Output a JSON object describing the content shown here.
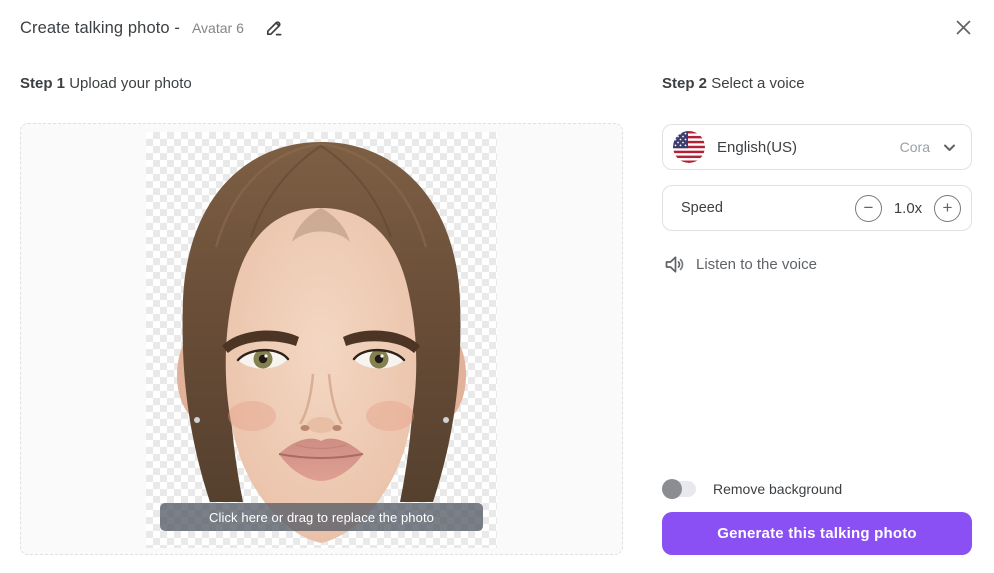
{
  "header": {
    "title": "Create talking photo -",
    "avatar_name": "Avatar 6"
  },
  "steps": {
    "step1_label": "Step 1",
    "step1_text": "Upload your photo",
    "step2_label": "Step 2",
    "step2_text": "Select a voice"
  },
  "upload": {
    "overlay_text": "Click here or drag to replace the photo",
    "photo_description": "woman-portrait-transparent-background"
  },
  "voice": {
    "language": "English(US)",
    "voice_name": "Cora",
    "flag_icon": "us-flag-icon"
  },
  "speed": {
    "label": "Speed",
    "value": "1.0x",
    "decrease_glyph": "−",
    "increase_glyph": "+"
  },
  "listen": {
    "label": "Listen to the voice",
    "icon": "speaker-icon"
  },
  "background_toggle": {
    "label": "Remove background",
    "state": "off"
  },
  "generate": {
    "label": "Generate this talking photo"
  },
  "colors": {
    "accent_purple": "#8b50f3",
    "border_gray": "#dfe1e5",
    "muted_text": "#9aa0a6",
    "overlay_bar": "rgba(86,92,102,0.78)"
  }
}
